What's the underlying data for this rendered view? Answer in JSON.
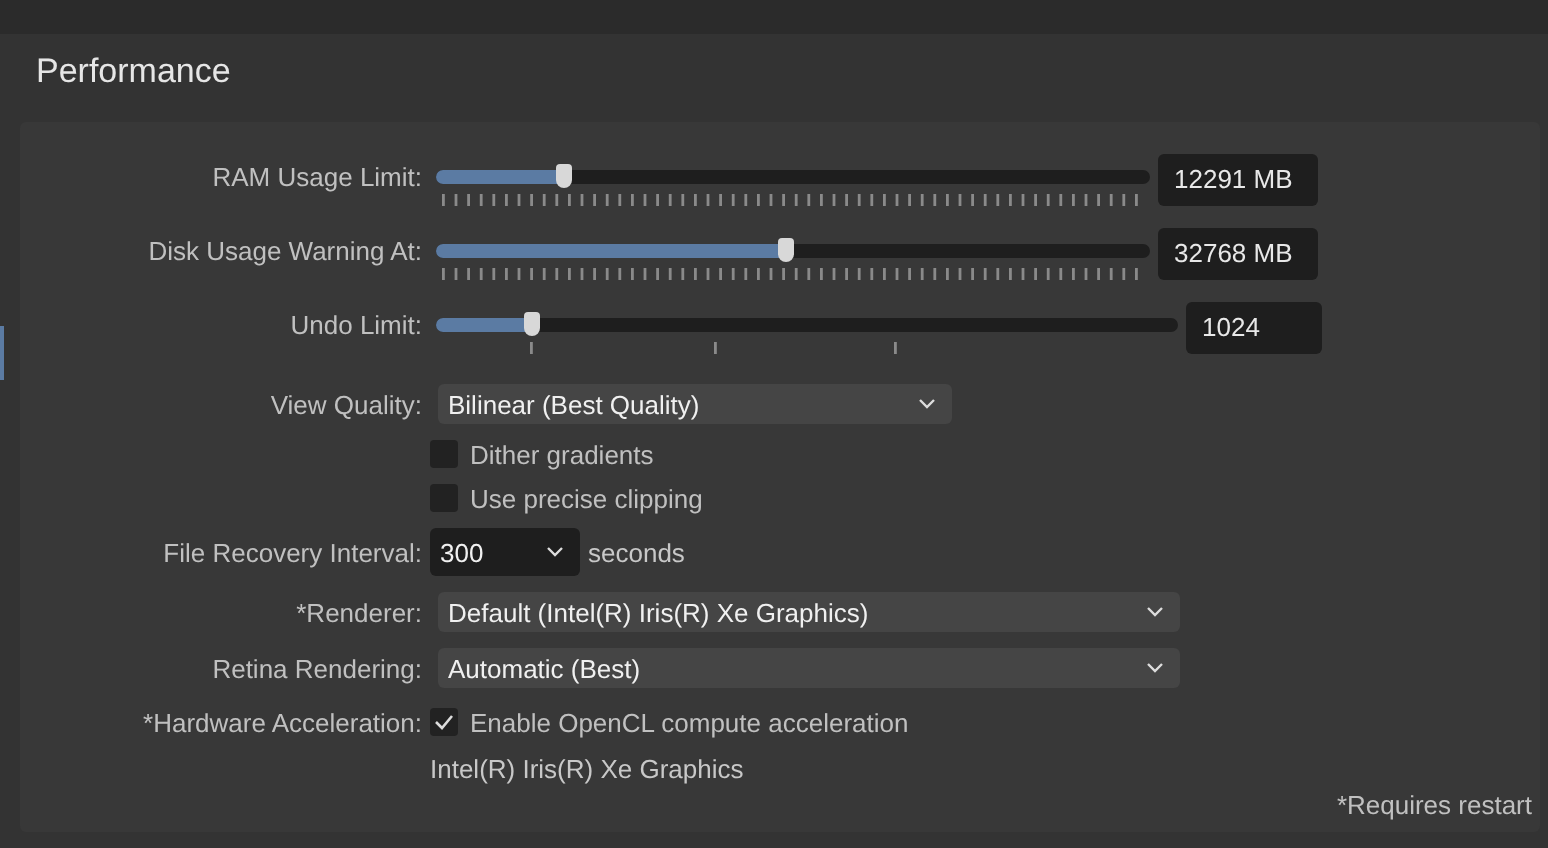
{
  "header": {
    "title": "Performance"
  },
  "sliders": [
    {
      "label": "RAM Usage Limit:",
      "level": 0.18,
      "value": "12291 MB",
      "kind": "dense"
    },
    {
      "label": "Disk Usage Warning At:",
      "level": 0.49,
      "value": "32768 MB",
      "kind": "dense"
    },
    {
      "label": "Undo Limit:",
      "level": 0.13,
      "value": "1024",
      "kind": "sparse"
    }
  ],
  "view_quality": {
    "label": "View Quality:",
    "value": "Bilinear (Best Quality)"
  },
  "checkboxes": [
    {
      "label": "Dither gradients",
      "checked": false
    },
    {
      "label": "Use precise clipping",
      "checked": false
    }
  ],
  "file_recovery": {
    "label": "File Recovery Interval:",
    "value": "300",
    "unit": "seconds"
  },
  "renderer": {
    "label": "*Renderer:",
    "value": "Default (Intel(R) Iris(R) Xe Graphics)"
  },
  "retina": {
    "label": "Retina Rendering:",
    "value": "Automatic (Best)"
  },
  "hardware_acceleration": {
    "label": "*Hardware Acceleration:",
    "option": "Enable OpenCL compute acceleration",
    "checked": true,
    "device": "Intel(R) Iris(R) Xe Graphics"
  },
  "footnote": "*Requires restart"
}
